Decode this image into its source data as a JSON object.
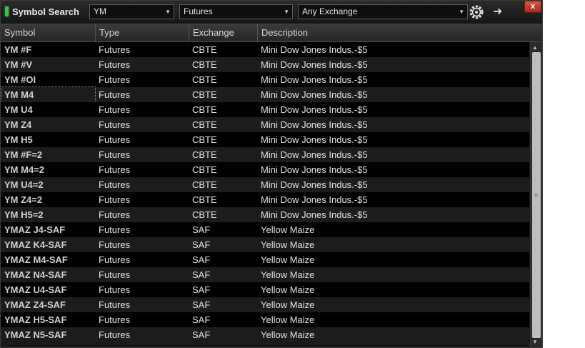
{
  "window": {
    "title": "Symbol Search",
    "close_label": "x"
  },
  "search": {
    "symbol_value": "YM",
    "type_value": "Futures",
    "exchange_value": "Any Exchange",
    "go_label": "➜"
  },
  "columns": [
    "Symbol",
    "Type",
    "Exchange",
    "Description"
  ],
  "rows": [
    {
      "symbol": "YM #F",
      "type": "Futures",
      "exchange": "CBTE",
      "description": "Mini Dow Jones Indus.-$5"
    },
    {
      "symbol": "YM #V",
      "type": "Futures",
      "exchange": "CBTE",
      "description": "Mini Dow Jones Indus.-$5"
    },
    {
      "symbol": "YM #OI",
      "type": "Futures",
      "exchange": "CBTE",
      "description": "Mini Dow Jones Indus.-$5"
    },
    {
      "symbol": "YM M4",
      "type": "Futures",
      "exchange": "CBTE",
      "description": "Mini Dow Jones Indus.-$5",
      "selected": true
    },
    {
      "symbol": "YM U4",
      "type": "Futures",
      "exchange": "CBTE",
      "description": "Mini Dow Jones Indus.-$5"
    },
    {
      "symbol": "YM Z4",
      "type": "Futures",
      "exchange": "CBTE",
      "description": "Mini Dow Jones Indus.-$5"
    },
    {
      "symbol": "YM H5",
      "type": "Futures",
      "exchange": "CBTE",
      "description": "Mini Dow Jones Indus.-$5"
    },
    {
      "symbol": "YM #F=2",
      "type": "Futures",
      "exchange": "CBTE",
      "description": "Mini Dow Jones Indus.-$5"
    },
    {
      "symbol": "YM M4=2",
      "type": "Futures",
      "exchange": "CBTE",
      "description": "Mini Dow Jones Indus.-$5"
    },
    {
      "symbol": "YM U4=2",
      "type": "Futures",
      "exchange": "CBTE",
      "description": "Mini Dow Jones Indus.-$5"
    },
    {
      "symbol": "YM Z4=2",
      "type": "Futures",
      "exchange": "CBTE",
      "description": "Mini Dow Jones Indus.-$5"
    },
    {
      "symbol": "YM H5=2",
      "type": "Futures",
      "exchange": "CBTE",
      "description": "Mini Dow Jones Indus.-$5"
    },
    {
      "symbol": "YMAZ J4-SAF",
      "type": "Futures",
      "exchange": "SAF",
      "description": "Yellow Maize"
    },
    {
      "symbol": "YMAZ K4-SAF",
      "type": "Futures",
      "exchange": "SAF",
      "description": "Yellow Maize"
    },
    {
      "symbol": "YMAZ M4-SAF",
      "type": "Futures",
      "exchange": "SAF",
      "description": "Yellow Maize"
    },
    {
      "symbol": "YMAZ N4-SAF",
      "type": "Futures",
      "exchange": "SAF",
      "description": "Yellow Maize"
    },
    {
      "symbol": "YMAZ U4-SAF",
      "type": "Futures",
      "exchange": "SAF",
      "description": "Yellow Maize"
    },
    {
      "symbol": "YMAZ Z4-SAF",
      "type": "Futures",
      "exchange": "SAF",
      "description": "Yellow Maize"
    },
    {
      "symbol": "YMAZ H5-SAF",
      "type": "Futures",
      "exchange": "SAF",
      "description": "Yellow Maize"
    },
    {
      "symbol": "YMAZ N5-SAF",
      "type": "Futures",
      "exchange": "SAF",
      "description": "Yellow Maize"
    }
  ],
  "colors": {
    "accent": "#3fc23f",
    "close": "#c0392b",
    "background": "#1a1a1a"
  },
  "icons": {
    "settings": "gear-icon",
    "go": "arrow-right-icon",
    "dropdown": "chevron-down-icon"
  }
}
